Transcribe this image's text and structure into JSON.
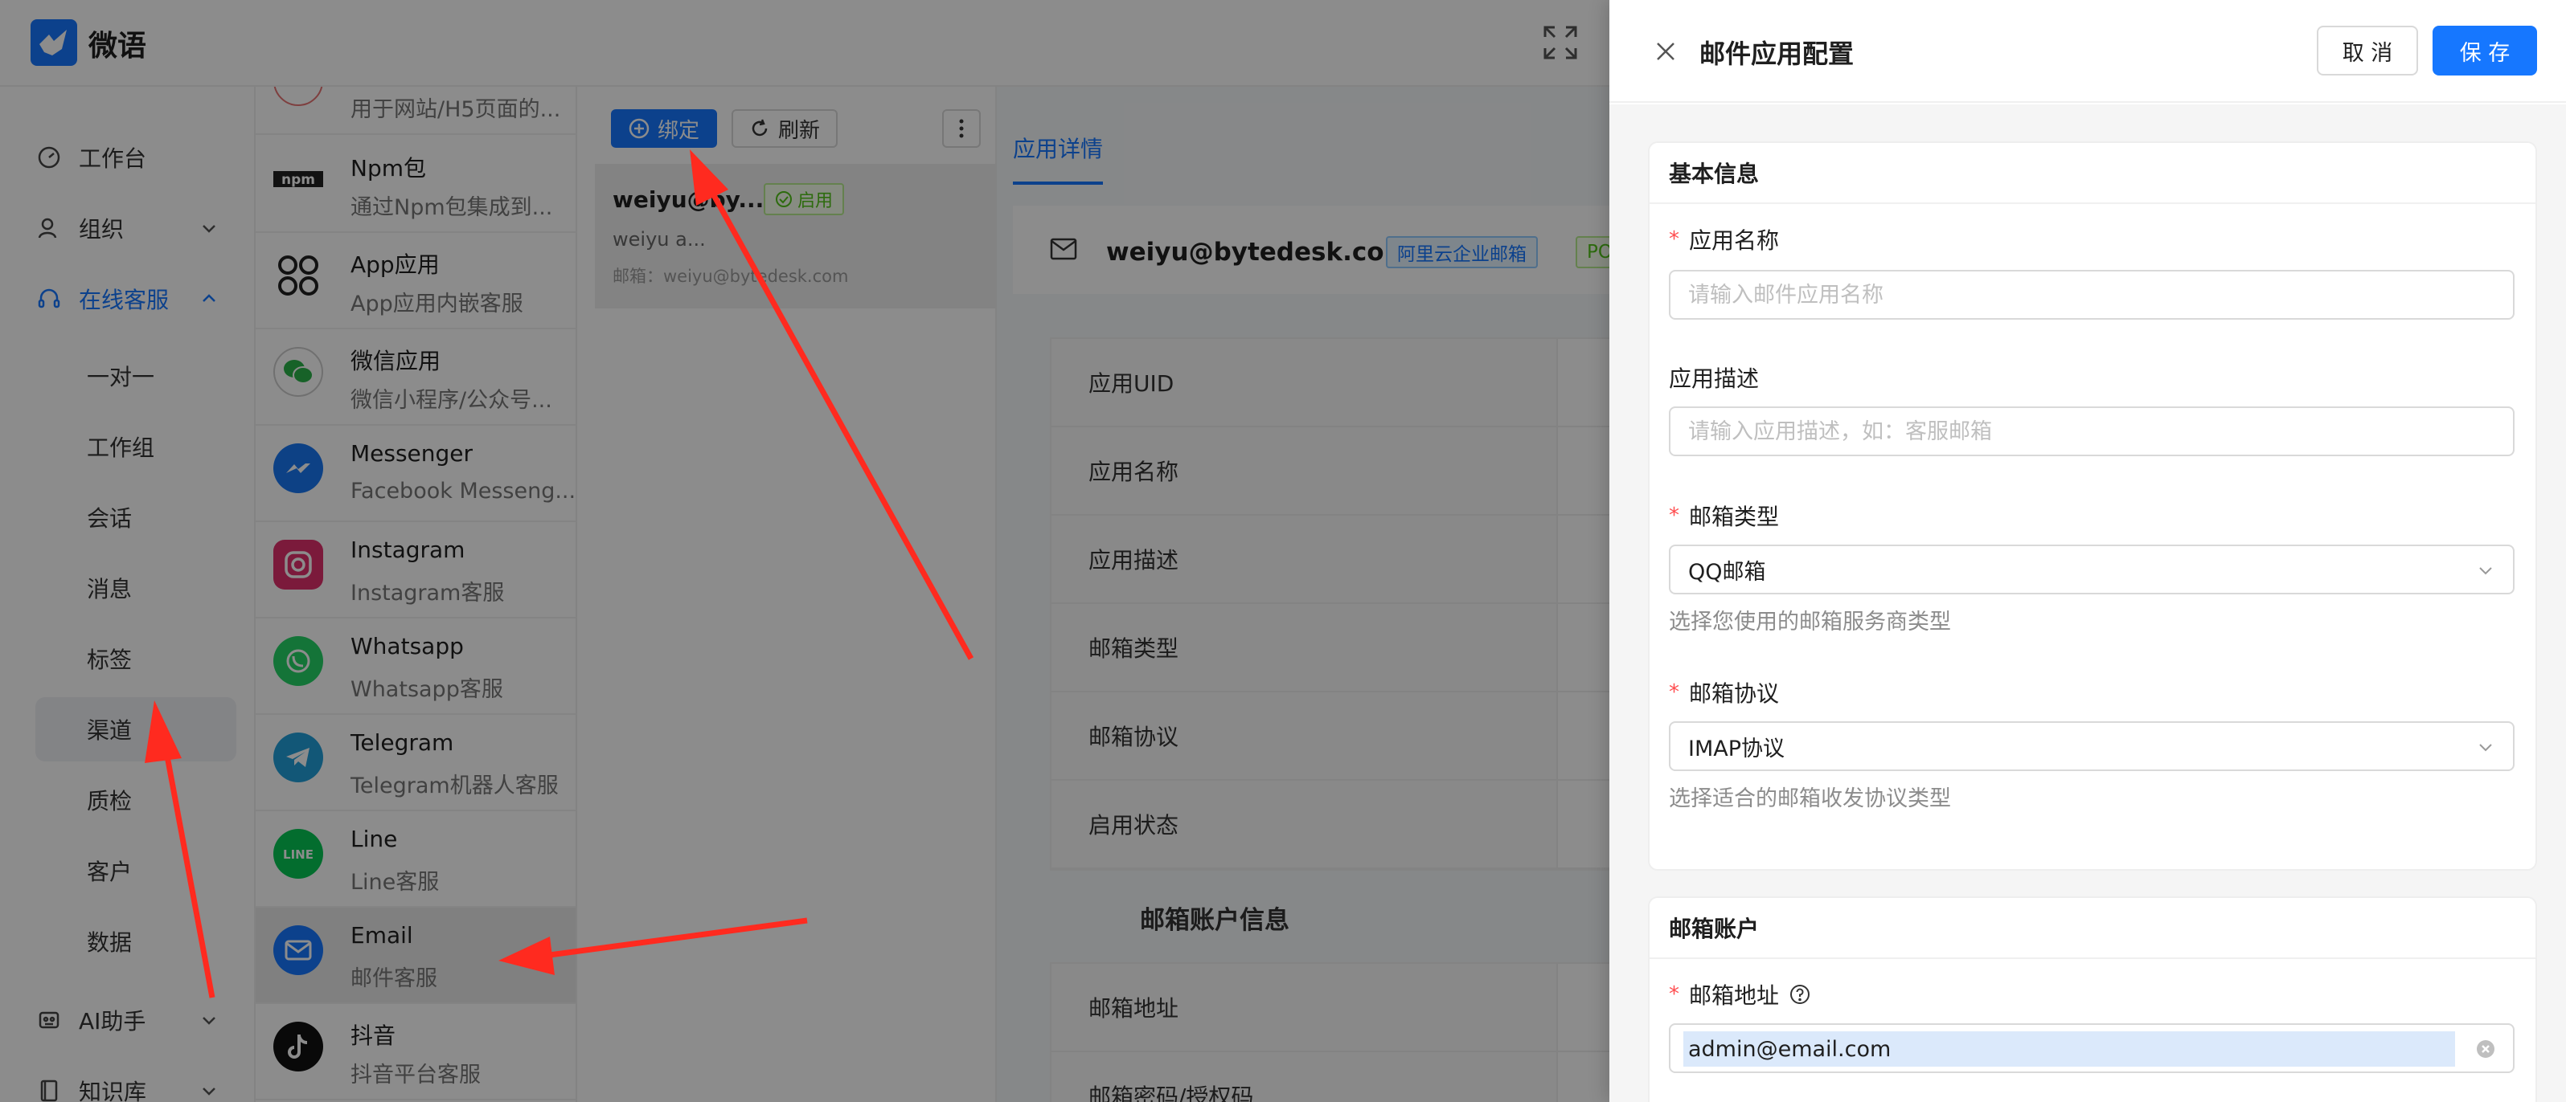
{
  "app": {
    "logo_text": "微语"
  },
  "sidebar": {
    "items": [
      {
        "label": "工作台"
      },
      {
        "label": "组织"
      },
      {
        "label": "在线客服"
      },
      {
        "label": "AI助手"
      },
      {
        "label": "知识库"
      }
    ],
    "sub_items": [
      {
        "label": "一对一"
      },
      {
        "label": "工作组"
      },
      {
        "label": "会话"
      },
      {
        "label": "消息"
      },
      {
        "label": "标签"
      },
      {
        "label": "渠道"
      },
      {
        "label": "质检"
      },
      {
        "label": "客户"
      },
      {
        "label": "数据"
      }
    ]
  },
  "channels": [
    {
      "name": "",
      "desc": "用于网站/H5页面的..."
    },
    {
      "name": "Npm包",
      "desc": "通过Npm包集成到..."
    },
    {
      "name": "App应用",
      "desc": "App应用内嵌客服"
    },
    {
      "name": "微信应用",
      "desc": "微信小程序/公众号..."
    },
    {
      "name": "Messenger",
      "desc": "Facebook Messeng..."
    },
    {
      "name": "Instagram",
      "desc": "Instagram客服"
    },
    {
      "name": "Whatsapp",
      "desc": "Whatsapp客服"
    },
    {
      "name": "Telegram",
      "desc": "Telegram机器人客服"
    },
    {
      "name": "Line",
      "desc": "Line客服"
    },
    {
      "name": "Email",
      "desc": "邮件客服"
    },
    {
      "name": "抖音",
      "desc": "抖音平台客服"
    }
  ],
  "apps_panel": {
    "bind_label": "绑定",
    "refresh_label": "刷新",
    "card": {
      "title": "weiyu@by...",
      "status": "启用",
      "subtitle": "weiyu a...",
      "email_line": "邮箱：weiyu@bytedesk.com"
    }
  },
  "detail": {
    "tab": "应用详情",
    "email": "weiyu@bytedesk.com",
    "tag_provider": "阿里云企业邮箱",
    "tag_protocol": "POP",
    "rows": [
      {
        "key": "应用UID"
      },
      {
        "key": "应用名称"
      },
      {
        "key": "应用描述"
      },
      {
        "key": "邮箱类型"
      },
      {
        "key": "邮箱协议"
      },
      {
        "key": "启用状态"
      }
    ],
    "section_title": "邮箱账户信息",
    "rows2": [
      {
        "key": "邮箱地址"
      },
      {
        "key": "邮箱密码/授权码"
      }
    ]
  },
  "drawer": {
    "title": "邮件应用配置",
    "cancel_label": "取 消",
    "save_label": "保 存",
    "basic_section": "基本信息",
    "name_label": "应用名称",
    "name_placeholder": "请输入邮件应用名称",
    "desc_label": "应用描述",
    "desc_placeholder": "请输入应用描述，如：客服邮箱",
    "type_label": "邮箱类型",
    "type_value": "QQ邮箱",
    "type_help": "选择您使用的邮箱服务商类型",
    "protocol_label": "邮箱协议",
    "protocol_value": "IMAP协议",
    "protocol_help": "选择适合的邮箱收发协议类型",
    "account_section": "邮箱账户",
    "email_label": "邮箱地址",
    "email_value": "admin@email.com"
  },
  "colors": {
    "primary": "#1677ff",
    "success": "#52c41a",
    "danger": "#ff4d4f",
    "annotation_arrow": "#ff2a1f"
  }
}
